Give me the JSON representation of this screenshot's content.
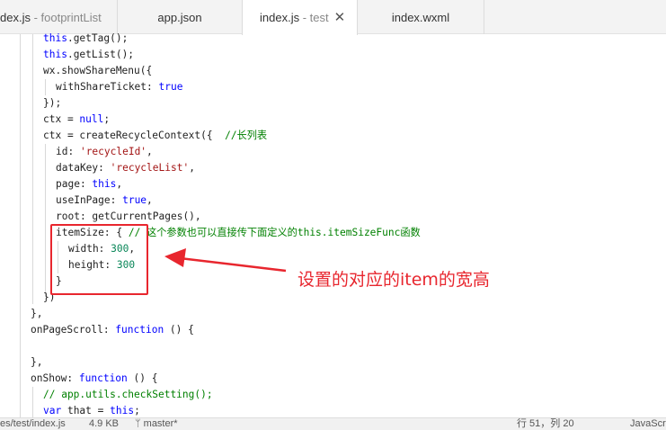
{
  "tabs": [
    {
      "name": "dex.js",
      "sub": " - footprintList"
    },
    {
      "name": "app.json",
      "sub": ""
    },
    {
      "name": "index.js",
      "sub": " - test",
      "active": true,
      "close": "✕"
    },
    {
      "name": "index.wxml",
      "sub": ""
    }
  ],
  "code_lines": [
    [
      {
        "t": "this",
        "k": "k"
      },
      {
        "t": ".getTag();"
      }
    ],
    [
      {
        "t": "this",
        "k": "k"
      },
      {
        "t": ".getList();"
      }
    ],
    [
      {
        "t": "wx.showShareMenu({"
      }
    ],
    [
      {
        "t": "withShareTicket: "
      },
      {
        "t": "true",
        "k": "k"
      }
    ],
    [
      {
        "t": "});"
      }
    ],
    [
      {
        "t": "ctx = "
      },
      {
        "t": "null",
        "k": "k"
      },
      {
        "t": ";"
      }
    ],
    [
      {
        "t": "ctx = createRecycleContext({  "
      },
      {
        "t": "//长列表",
        "k": "c"
      }
    ],
    [
      {
        "t": "id: "
      },
      {
        "t": "'recycleId'",
        "k": "s"
      },
      {
        "t": ","
      }
    ],
    [
      {
        "t": "dataKey: "
      },
      {
        "t": "'recycleList'",
        "k": "s"
      },
      {
        "t": ","
      }
    ],
    [
      {
        "t": "page: "
      },
      {
        "t": "this",
        "k": "k"
      },
      {
        "t": ","
      }
    ],
    [
      {
        "t": "useInPage: "
      },
      {
        "t": "true",
        "k": "k"
      },
      {
        "t": ","
      }
    ],
    [
      {
        "t": "root: getCurrentPages(),"
      }
    ],
    [
      {
        "t": "itemSize: { "
      },
      {
        "t": "// 这个参数也可以直接传下面定义的this.itemSizeFunc函数",
        "k": "c"
      }
    ],
    [
      {
        "t": "width: "
      },
      {
        "t": "300",
        "k": "n"
      },
      {
        "t": ","
      }
    ],
    [
      {
        "t": "height: "
      },
      {
        "t": "300",
        "k": "n"
      }
    ],
    [
      {
        "t": "}"
      }
    ],
    [
      {
        "t": "})"
      }
    ],
    [
      {
        "t": "},"
      }
    ],
    [
      {
        "t": "onPageScroll: "
      },
      {
        "t": "function",
        "k": "k"
      },
      {
        "t": " () {"
      }
    ],
    [],
    [
      {
        "t": "},"
      }
    ],
    [
      {
        "t": "onShow: "
      },
      {
        "t": "function",
        "k": "k"
      },
      {
        "t": " () {"
      }
    ],
    [
      {
        "t": "// app.utils.checkSetting();",
        "k": "c"
      }
    ],
    [
      {
        "t": "var",
        "k": "k"
      },
      {
        "t": " that = "
      },
      {
        "t": "this",
        "k": "k"
      },
      {
        "t": ";"
      }
    ]
  ],
  "annotation": "设置的对应的item的宽高",
  "status": {
    "path": "es/test/index.js",
    "size": "4.9 KB",
    "branch": "ᛘ master*",
    "row": "行 51，列 20",
    "lang": "JavaScr"
  },
  "colors": {
    "annotation_red": "#e8262e",
    "keyword": "#0000ff",
    "string": "#a31515",
    "number": "#098658",
    "comment": "#008000"
  }
}
